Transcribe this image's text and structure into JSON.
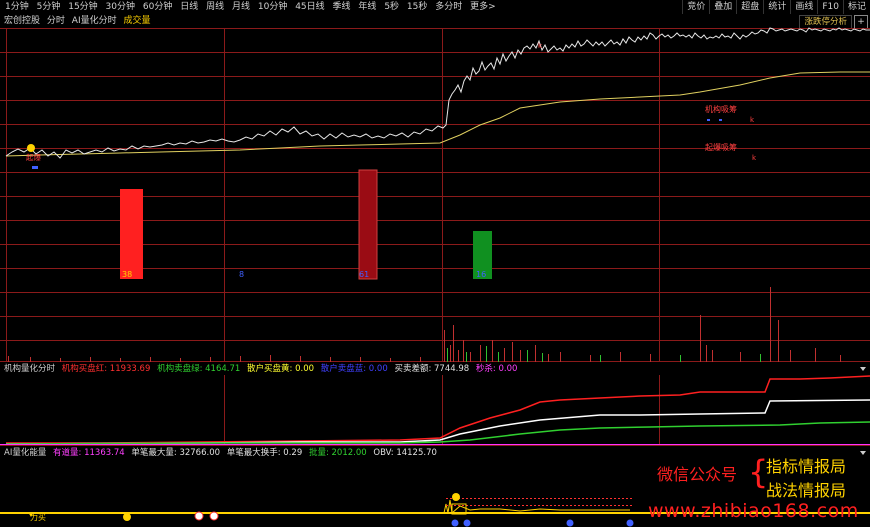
{
  "toolbar": {
    "periods": [
      "1分钟",
      "5分钟",
      "15分钟",
      "30分钟",
      "60分钟",
      "日线",
      "周线",
      "月线",
      "10分钟",
      "45日线",
      "季线",
      "年线",
      "5秒",
      "15秒",
      "多分时",
      "更多>"
    ],
    "right_buttons": [
      "竞价",
      "叠加",
      "超盘",
      "统计",
      "画线",
      "F10",
      "标记"
    ]
  },
  "subheader": {
    "items": [
      "宏创控股",
      "分时",
      "AI量化分时",
      "成交量"
    ]
  },
  "top_tag": {
    "label": "涨跌停分析",
    "button": "+"
  },
  "main_panel": {
    "annotations": [
      "机构吸筹",
      "起爆吸筹"
    ],
    "bar_labels": [
      "38",
      "8",
      "61",
      "16"
    ],
    "start_mark": "起爆"
  },
  "panel2": {
    "title": "机构量化分时",
    "items": [
      {
        "label": "机构买盘红: ",
        "value": "11933.69",
        "color": "#ff3030"
      },
      {
        "label": "机构卖盘绿: ",
        "value": "4164.71",
        "color": "#30d030"
      },
      {
        "label": "散户买盘黄: ",
        "value": "0.00",
        "color": "#ffff30"
      },
      {
        "label": "散户卖盘蓝: ",
        "value": "0.00",
        "color": "#4040ff"
      },
      {
        "label": "买卖差额: ",
        "value": "7744.98",
        "color": "#e0e0e0"
      },
      {
        "label": "秒杀: ",
        "value": "0.00",
        "color": "#ff40ff"
      }
    ]
  },
  "panel3": {
    "title": "AI量化能量",
    "items": [
      {
        "label": "有道量: ",
        "value": "11363.74",
        "color": "#ff40ff"
      },
      {
        "label": "单笔最大量: ",
        "value": "32766.00",
        "color": "#e0e0e0"
      },
      {
        "label": "单笔最大换手: ",
        "value": "0.29",
        "color": "#e0e0e0"
      },
      {
        "label": "批量: ",
        "value": "2012.00",
        "color": "#30d030"
      },
      {
        "label": "OBV: ",
        "value": "14125.70",
        "color": "#e0e0e0"
      }
    ],
    "bottom_mark": "力买"
  },
  "watermark": {
    "line1": "微信公众号",
    "tag1": "指标情报局",
    "tag2": "战法情报局",
    "url": "www.zhibiao168.com"
  },
  "colors": {
    "grid": "#8b1a1a",
    "price": "#e8e8e8",
    "avg": "#e0d060",
    "accent": "#ffd200"
  }
}
